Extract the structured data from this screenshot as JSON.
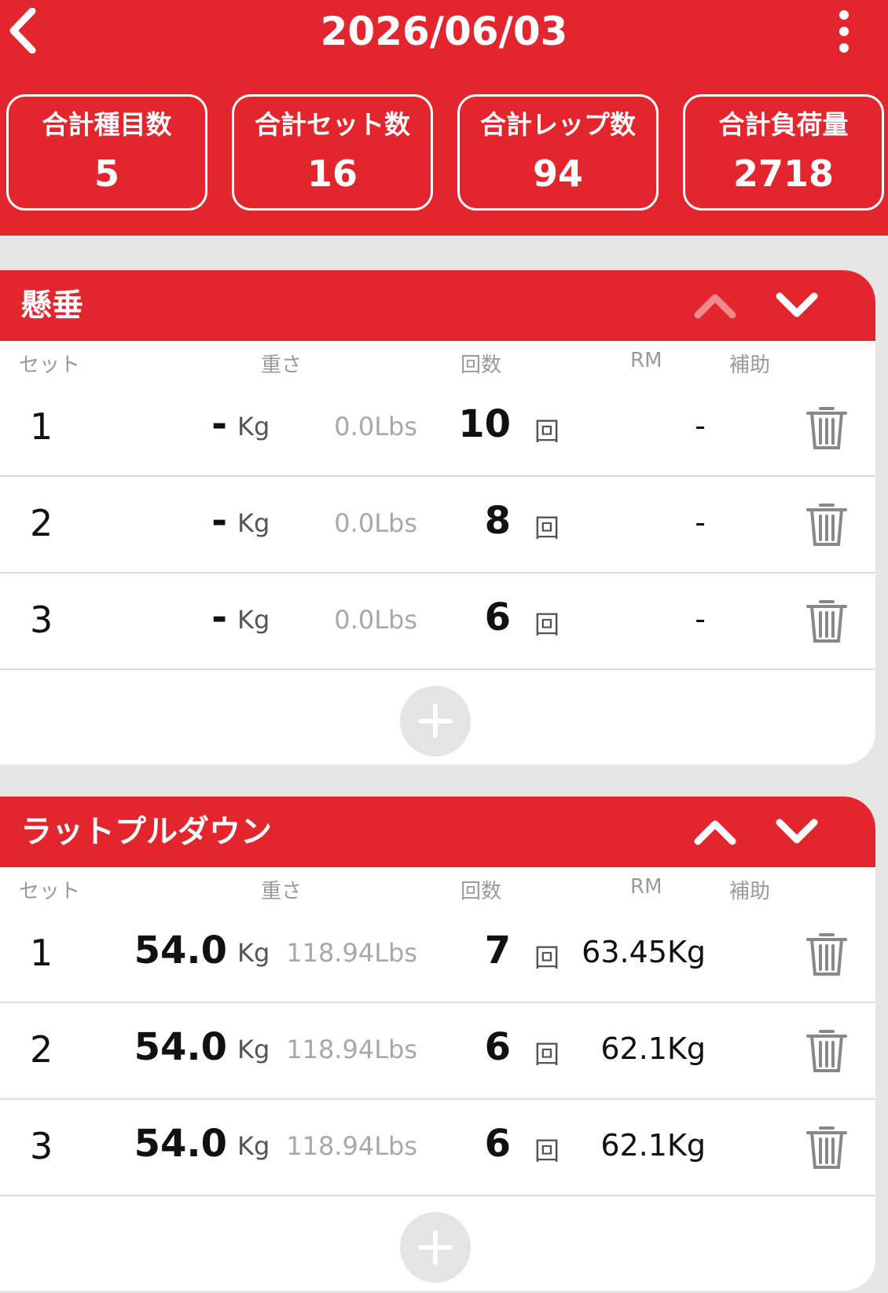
{
  "header": {
    "title": "2026/06/03",
    "back_icon": "chevron-left-icon",
    "more_icon": "more-vertical-icon"
  },
  "stats": [
    {
      "label": "合計種目数",
      "value": "5"
    },
    {
      "label": "合計セット数",
      "value": "16"
    },
    {
      "label": "合計レップ数",
      "value": "94"
    },
    {
      "label": "合計負荷量",
      "value": "2718"
    }
  ],
  "columns": {
    "set": "セット",
    "weight": "重さ",
    "reps": "回数",
    "rm": "RM",
    "assist": "補助"
  },
  "units": {
    "kg": "Kg",
    "reps": "回"
  },
  "exercises": [
    {
      "name": "懸垂",
      "up_enabled": false,
      "sets": [
        {
          "set": "1",
          "weight": "-",
          "lbs": "0.0Lbs",
          "reps": "10",
          "rm": "-"
        },
        {
          "set": "2",
          "weight": "-",
          "lbs": "0.0Lbs",
          "reps": "8",
          "rm": "-"
        },
        {
          "set": "3",
          "weight": "-",
          "lbs": "0.0Lbs",
          "reps": "6",
          "rm": "-"
        }
      ]
    },
    {
      "name": "ラットプルダウン",
      "up_enabled": true,
      "sets": [
        {
          "set": "1",
          "weight": "54.0",
          "lbs": "118.94Lbs",
          "reps": "7",
          "rm": "63.45Kg"
        },
        {
          "set": "2",
          "weight": "54.0",
          "lbs": "118.94Lbs",
          "reps": "6",
          "rm": "62.1Kg"
        },
        {
          "set": "3",
          "weight": "54.0",
          "lbs": "118.94Lbs",
          "reps": "6",
          "rm": "62.1Kg"
        }
      ]
    }
  ],
  "colors": {
    "accent": "#e3252e",
    "disabled_up": "#f08a8f",
    "background": "#e6e6e6"
  }
}
